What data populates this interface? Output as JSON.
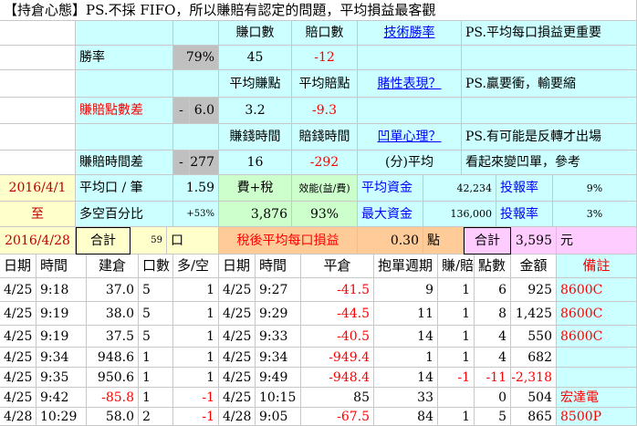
{
  "title": "【持倉心態】PS.不採 FIFO，所以賺賠有認定的問題，平均損益最客觀",
  "stats": {
    "h_win_count": "賺口數",
    "h_loss_count": "賠口數",
    "tech_link": "技術勝率",
    "note1": "PS.平均每口損益更重要",
    "win_rate_label": "勝率",
    "win_rate": "79%",
    "win_count": "45",
    "loss_count": "-12",
    "h_avg_win_pts": "平均賺點",
    "h_avg_loss_pts": "平均賠點",
    "gamble_link": "賭性表現？",
    "note2": "PS.贏要衝，輸要縮",
    "pts_diff_label": "賺賠點數差",
    "pts_diff_sign": "-",
    "pts_diff": "6.0",
    "avg_win_pts": "3.2",
    "avg_loss_pts": "-9.3",
    "h_win_time": "賺錢時間",
    "h_loss_time": "賠錢時間",
    "trap_link": "凹單心理？",
    "note3": "PS.有可能是反轉才出場",
    "time_diff_label": "賺賠時間差",
    "time_diff_sign": "-",
    "time_diff": "277",
    "win_time": "16",
    "loss_time": "-292",
    "time_unit": "(分)平均",
    "note4": "看起來變凹單，參考",
    "date_start": "2016/4/1",
    "date_to": "至",
    "date_end": "2016/4/28",
    "avg_per_lot_label": "平均口 / 筆",
    "avg_per_lot": "1.59",
    "fee_tax_label": "費+稅",
    "efficiency_label": "效能(益/費)",
    "avg_capital_label": "平均資金",
    "avg_capital": "42,234",
    "roi_label": "投報率",
    "roi": "9%",
    "long_short_label": "多空百分比",
    "long_short": "+53%",
    "fee_tax": "3,876",
    "efficiency": "93%",
    "max_capital_label": "最大資金",
    "max_capital": "136,000",
    "roi2_label": "投報率",
    "roi2": "3%",
    "total_label": "合計",
    "total_lots": "59",
    "total_lots_unit": "口",
    "after_tax_label": "稅後平均每口損益",
    "after_tax": "0.30",
    "after_tax_unit": "點",
    "total2_label": "合計",
    "total_amount": "3,595",
    "total_amount_unit": "元"
  },
  "table": {
    "headers": [
      "日期",
      "時間",
      "建倉",
      "口數",
      "多/空",
      "日期",
      "時間",
      "平倉",
      "抱單週期",
      "賺/賠",
      "點數",
      "金額",
      "備註"
    ],
    "rows": [
      [
        "4/25",
        "9:18",
        "37.0",
        "5",
        "1",
        "4/25",
        "9:27",
        "-41.5",
        "9",
        "1",
        "6",
        "925",
        "8600C"
      ],
      [
        "4/25",
        "9:19",
        "38.0",
        "5",
        "1",
        "4/25",
        "9:29",
        "-44.5",
        "11",
        "1",
        "8",
        "1,425",
        "8600C"
      ],
      [
        "4/25",
        "9:19",
        "37.5",
        "5",
        "1",
        "4/25",
        "9:33",
        "-40.5",
        "14",
        "1",
        "4",
        "550",
        "8600C"
      ],
      [
        "4/25",
        "9:34",
        "948.6",
        "1",
        "1",
        "4/25",
        "9:34",
        "-949.4",
        "1",
        "1",
        "4",
        "682",
        ""
      ],
      [
        "4/25",
        "9:35",
        "950.6",
        "1",
        "1",
        "4/25",
        "9:49",
        "-948.4",
        "14",
        "-1",
        "-11",
        "-2,318",
        ""
      ],
      [
        "4/25",
        "9:42",
        "-85.8",
        "1",
        "-1",
        "4/25",
        "10:15",
        "85",
        "33",
        "",
        "0",
        "504",
        "宏達電"
      ],
      [
        "4/28",
        "10:29",
        "58.0",
        "2",
        "-1",
        "4/28",
        "9:05",
        "-67.5",
        "84",
        "1",
        "5",
        "865",
        "8500P"
      ]
    ]
  }
}
